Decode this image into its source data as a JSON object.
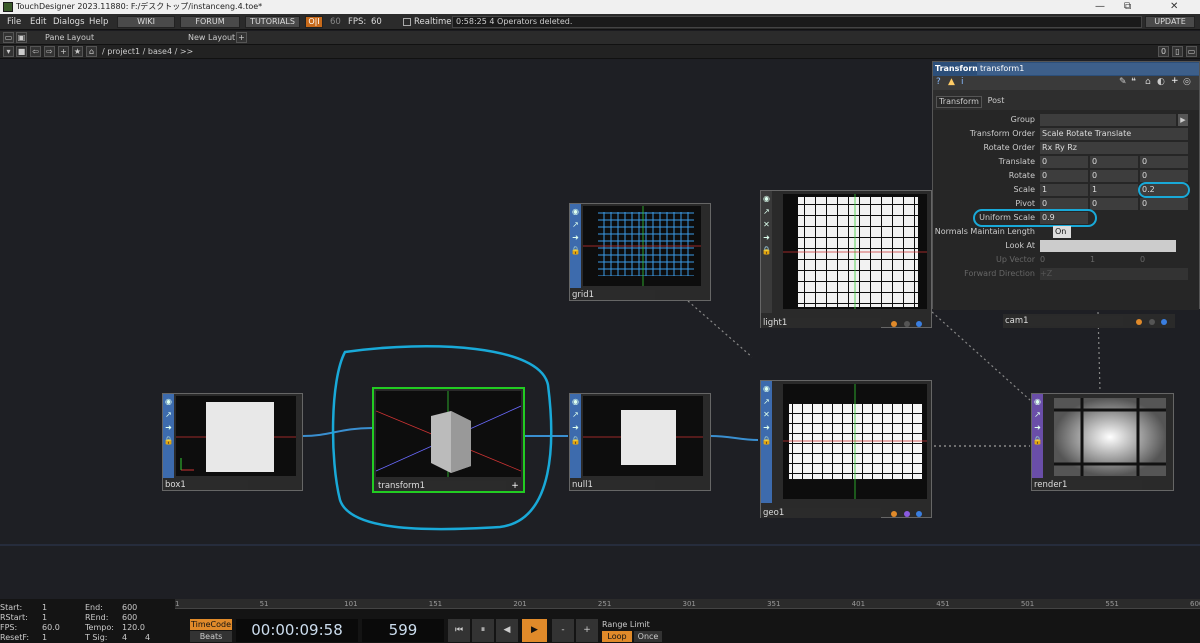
{
  "window": {
    "title": "TouchDesigner 2023.11880: F:/デスクトップ/instanceng.4.toe*",
    "min": "—",
    "max": "⧉",
    "close": "✕"
  },
  "menu": {
    "items": [
      "File",
      "Edit",
      "Dialogs",
      "Help"
    ],
    "wiki": "WIKI",
    "forum": "FORUM",
    "tutorials": "TUTORIALS",
    "oi": "O|I",
    "fps_target": "60",
    "fps_label": "FPS:",
    "fps_value": "60",
    "realtime": "Realtime",
    "status": "0:58:25 4 Operators deleted.",
    "update": "UPDATE"
  },
  "toolbar2": {
    "pane_layout": "Pane Layout",
    "new_layout": "New Layout",
    "plus": "+"
  },
  "pathbar": {
    "path": "/ project1 / base4 / >>",
    "count": "0"
  },
  "nodes": {
    "grid1": "grid1",
    "light1": "light1",
    "cam1": "cam1",
    "box1": "box1",
    "transform1": "transform1",
    "null1": "null1",
    "geo1": "geo1",
    "render1": "render1"
  },
  "panel": {
    "header": "Transform",
    "op_name": "transform1",
    "tabs": [
      "Transform",
      "Post"
    ],
    "rows": [
      {
        "label": "Group",
        "values": [
          ""
        ]
      },
      {
        "label": "Transform Order",
        "values": [
          "Scale Rotate Translate"
        ]
      },
      {
        "label": "Rotate Order",
        "values": [
          "Rx Ry Rz"
        ]
      },
      {
        "label": "Translate",
        "values": [
          "0",
          "0",
          "0"
        ]
      },
      {
        "label": "Rotate",
        "values": [
          "0",
          "0",
          "0"
        ]
      },
      {
        "label": "Scale",
        "values": [
          "1",
          "1",
          "0.2"
        ]
      },
      {
        "label": "Pivot",
        "values": [
          "0",
          "0",
          "0"
        ]
      },
      {
        "label": "Uniform Scale",
        "values": [
          "0.9"
        ]
      },
      {
        "label": "Normals Maintain Length",
        "values": [
          "On"
        ]
      },
      {
        "label": "Look At",
        "values": [
          ""
        ]
      },
      {
        "label": "Up Vector",
        "values": [
          "0",
          "1",
          "0"
        ]
      },
      {
        "label": "Forward Direction",
        "values": [
          "+Z"
        ]
      }
    ]
  },
  "timeline": {
    "ruler": [
      "1",
      "51",
      "101",
      "151",
      "201",
      "251",
      "301",
      "351",
      "401",
      "451",
      "501",
      "551",
      "600"
    ],
    "start_label": "Start:",
    "start": "1",
    "rstart_label": "RStart:",
    "rstart": "1",
    "fps_label": "FPS:",
    "fps": "60.0",
    "resetf_label": "ResetF:",
    "resetf": "1",
    "end_label": "End:",
    "end": "600",
    "rend_label": "REnd:",
    "rend": "600",
    "tempo_label": "Tempo:",
    "tempo": "120.0",
    "tsig_label": "T Sig:",
    "tsig_a": "4",
    "tsig_b": "4",
    "timecode_btn": "TimeCode",
    "beats_btn": "Beats",
    "timecode": "00:00:09:58",
    "frame": "599",
    "range_limit": "Range Limit",
    "loop": "Loop",
    "once": "Once",
    "minus": "-",
    "plus": "+"
  },
  "colors": {
    "accent": "#3d6bad",
    "highlight": "#00aadd",
    "selected": "#22cc22",
    "orange": "#e08a2a"
  }
}
